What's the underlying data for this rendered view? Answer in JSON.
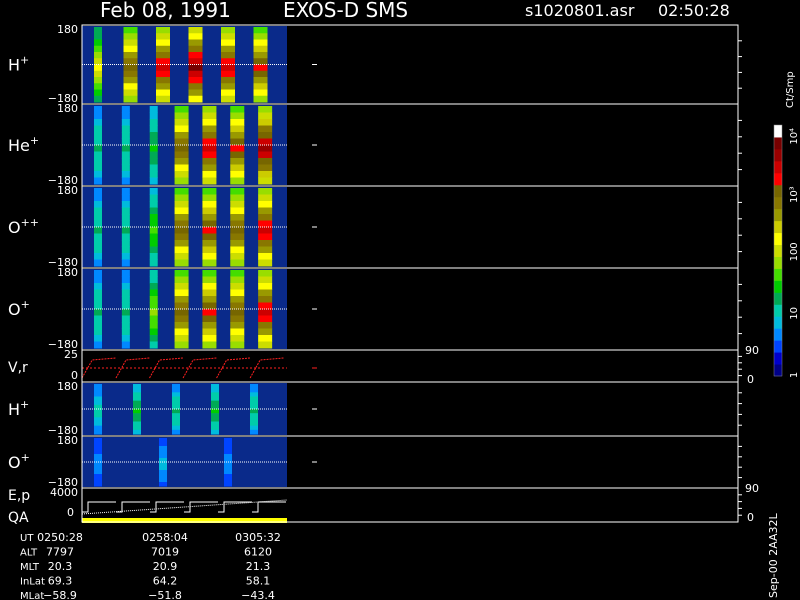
{
  "header": {
    "date": "Feb 08, 1991",
    "instrument": "EXOS-D SMS",
    "file": "s1020801.asr",
    "time": "02:50:28"
  },
  "colorbar": {
    "unit": "Ct/Smp",
    "tick_labels": [
      "1",
      "10",
      "100",
      "10³",
      "10⁴"
    ],
    "tick_values": [
      1,
      10,
      100,
      1000,
      10000
    ],
    "colors": [
      "#000088",
      "#0000cc",
      "#0044ff",
      "#0088ff",
      "#00bbdd",
      "#00ccaa",
      "#00aa55",
      "#00cc00",
      "#44dd00",
      "#99dd00",
      "#ccdd00",
      "#ffff00",
      "#cccc00",
      "#999900",
      "#887700",
      "#776600",
      "#ff0000",
      "#cc0000",
      "#990000",
      "#770000",
      "#ffffff"
    ]
  },
  "chart_data": [
    {
      "type": "heatmap",
      "label_main": "H",
      "label_sup": "+",
      "y_ticks": [
        "180",
        "−180"
      ],
      "ylim": [
        -180,
        180
      ],
      "bands": [
        {
          "t": "02:51:40",
          "level": 0.55
        },
        {
          "t": "02:53:20",
          "level": 0.75
        },
        {
          "t": "02:55:00",
          "level": 0.85
        },
        {
          "t": "02:57:50",
          "level": 0.95
        },
        {
          "t": "03:00:40",
          "level": 0.85
        },
        {
          "t": "03:03:20",
          "level": 0.8
        }
      ]
    },
    {
      "type": "heatmap",
      "label_main": "He",
      "label_sup": "+",
      "y_ticks": [
        "180",
        "−180"
      ],
      "ylim": [
        -180,
        180
      ],
      "bands": [
        {
          "t": "02:51:10",
          "level": 0.3
        },
        {
          "t": "02:52:50",
          "level": 0.3
        },
        {
          "t": "02:54:30",
          "level": 0.35
        },
        {
          "t": "02:55:50",
          "level": 0.75
        },
        {
          "t": "02:58:20",
          "level": 0.85
        },
        {
          "t": "03:00:50",
          "level": 0.8
        },
        {
          "t": "03:03:20",
          "level": 0.9
        }
      ]
    },
    {
      "type": "heatmap",
      "label_main": "O",
      "label_sup": "++",
      "y_ticks": [
        "180",
        "−180"
      ],
      "ylim": [
        -180,
        180
      ],
      "bands": [
        {
          "t": "02:51:10",
          "level": 0.3
        },
        {
          "t": "02:52:50",
          "level": 0.3
        },
        {
          "t": "02:54:30",
          "level": 0.4
        },
        {
          "t": "02:55:50",
          "level": 0.75
        },
        {
          "t": "02:58:20",
          "level": 0.8
        },
        {
          "t": "03:00:50",
          "level": 0.75
        },
        {
          "t": "03:03:20",
          "level": 0.85
        }
      ]
    },
    {
      "type": "heatmap",
      "label_main": "O",
      "label_sup": "+",
      "y_ticks": [
        "180",
        "−180"
      ],
      "ylim": [
        -180,
        180
      ],
      "bands": [
        {
          "t": "02:51:10",
          "level": 0.3
        },
        {
          "t": "02:52:50",
          "level": 0.3
        },
        {
          "t": "02:54:30",
          "level": 0.45
        },
        {
          "t": "02:55:50",
          "level": 0.75
        },
        {
          "t": "02:58:20",
          "level": 0.8
        },
        {
          "t": "03:00:50",
          "level": 0.75
        },
        {
          "t": "03:03:20",
          "level": 0.85
        }
      ]
    },
    {
      "type": "line",
      "label": "V,r",
      "y_ticks_left": [
        "25",
        "0"
      ],
      "ylim_left": [
        0,
        25
      ],
      "y_ticks_right": [
        "90",
        "0"
      ],
      "ylim_right": [
        0,
        90
      ],
      "sweeps": [
        {
          "t_start": "02:50:28",
          "t_end": "02:53:00"
        },
        {
          "t_start": "02:53:00",
          "t_end": "02:55:30"
        },
        {
          "t_start": "02:55:30",
          "t_end": "02:58:00"
        },
        {
          "t_start": "02:58:00",
          "t_end": "03:00:30"
        },
        {
          "t_start": "03:00:30",
          "t_end": "03:03:00"
        },
        {
          "t_start": "03:03:00",
          "t_end": "03:05:30"
        }
      ]
    },
    {
      "type": "heatmap",
      "label_main": "H",
      "label_sup": "+",
      "y_ticks": [
        "180",
        "−180"
      ],
      "ylim": [
        -180,
        180
      ],
      "bands": [
        {
          "t": "02:52:00",
          "level": 0.25
        },
        {
          "t": "02:54:40",
          "level": 0.35
        },
        {
          "t": "02:57:00",
          "level": 0.3
        },
        {
          "t": "03:00:00",
          "level": 0.35
        },
        {
          "t": "03:03:00",
          "level": 0.3
        }
      ]
    },
    {
      "type": "heatmap",
      "label_main": "O",
      "label_sup": "+",
      "y_ticks": [
        "180",
        "−180"
      ],
      "ylim": [
        -180,
        180
      ],
      "bands": [
        {
          "t": "02:57:00",
          "level": 0.15
        },
        {
          "t": "03:01:00",
          "level": 0.2
        },
        {
          "t": "03:04:00",
          "level": 0.15
        }
      ]
    },
    {
      "type": "line",
      "label_top": "E,p",
      "label_bottom": "QA",
      "y_ticks_left": [
        "4000",
        "0"
      ],
      "ylim_left": [
        0,
        4000
      ],
      "y_ticks_right": [
        "90",
        "0"
      ],
      "ylim_right": [
        0,
        90
      ]
    }
  ],
  "time_axis": {
    "start": "02:50:28",
    "end": "03:05:45",
    "data_end": "03:05:45"
  },
  "ephemeris": {
    "rows": [
      {
        "label": "UT",
        "values": [
          "0250:28",
          "0258:04",
          "0305:32"
        ]
      },
      {
        "label": "ALT",
        "values": [
          "7797",
          "7019",
          "6120"
        ]
      },
      {
        "label": "MLT",
        "values": [
          "20.3",
          "20.9",
          "21.3"
        ]
      },
      {
        "label": "InLat",
        "values": [
          "69.3",
          "64.2",
          "58.1"
        ]
      },
      {
        "label": "MLat",
        "values": [
          "−58.9",
          "−51.8",
          "−43.4"
        ]
      }
    ]
  },
  "footer_note": "Sep-00 2AA32L"
}
